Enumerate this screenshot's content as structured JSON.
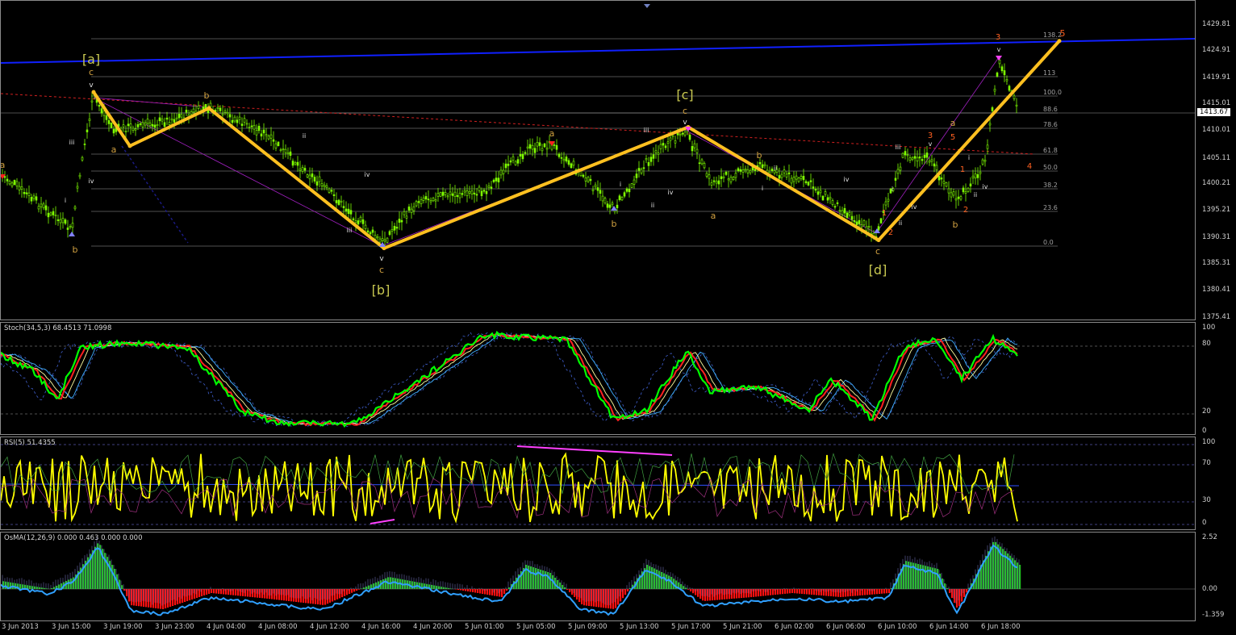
{
  "price_axis": [
    "1429.81",
    "1424.91",
    "1419.91",
    "1415.01",
    "1410.01",
    "1405.11",
    "1400.21",
    "1395.21",
    "1390.31",
    "1385.31",
    "1380.41",
    "1375.41"
  ],
  "current_price": "1413.67",
  "time_axis": [
    "3 Jun 2013",
    "3 Jun 15:00",
    "3 Jun 19:00",
    "3 Jun 23:00",
    "4 Jun 04:00",
    "4 Jun 08:00",
    "4 Jun 12:00",
    "4 Jun 16:00",
    "4 Jun 20:00",
    "5 Jun 01:00",
    "5 Jun 05:00",
    "5 Jun 09:00",
    "5 Jun 13:00",
    "5 Jun 17:00",
    "5 Jun 21:00",
    "6 Jun 02:00",
    "6 Jun 06:00",
    "6 Jun 10:00",
    "6 Jun 14:00",
    "6 Jun 18:00"
  ],
  "fib_levels": [
    "138.2",
    "113",
    "100.0",
    "88.6",
    "78.6",
    "61.8",
    "50.0",
    "38.2",
    "23.6",
    "0.0"
  ],
  "stoch": {
    "title": "Stoch(34,5,3) 68.4513 71.0998",
    "axis": [
      "100",
      "80",
      "20",
      "0"
    ]
  },
  "rsi": {
    "title": "RSI(5) 51.4355",
    "axis": [
      "100",
      "70",
      "30",
      "0"
    ]
  },
  "osma": {
    "title": "OsMA(12,26,9) 0.000 0.463 0.000 0.000",
    "axis": [
      "2.52",
      "0.00",
      "-1.359"
    ]
  },
  "major_waves": [
    "[a]",
    "[b]",
    "[c]",
    "[d]"
  ],
  "colors": {
    "bg": "#000000",
    "candle": "#7fff00",
    "zigzag": "#ffc020",
    "channel": "#1020ff",
    "stoch_main": "#00ff00",
    "stoch_signal": "#ff2020",
    "rsi": "#ffff00",
    "osma_up": "#20c020",
    "osma_down": "#ff1010"
  },
  "chart_data": {
    "type": "line",
    "title": "",
    "series": [
      {
        "x": [
          "3 Jun 15:00",
          "3 Jun 19:00",
          "4 Jun 04:00",
          "4 Jun 16:00",
          "5 Jun 17:00",
          "6 Jun 06:00",
          "6 Jun 18:00"
        ],
        "values": [
          1417.5,
          1407.5,
          1414.5,
          1388.5,
          1411.0,
          1390.0,
          1427.0
        ]
      }
    ],
    "ylim": [
      1375.41,
      1431.0
    ]
  }
}
